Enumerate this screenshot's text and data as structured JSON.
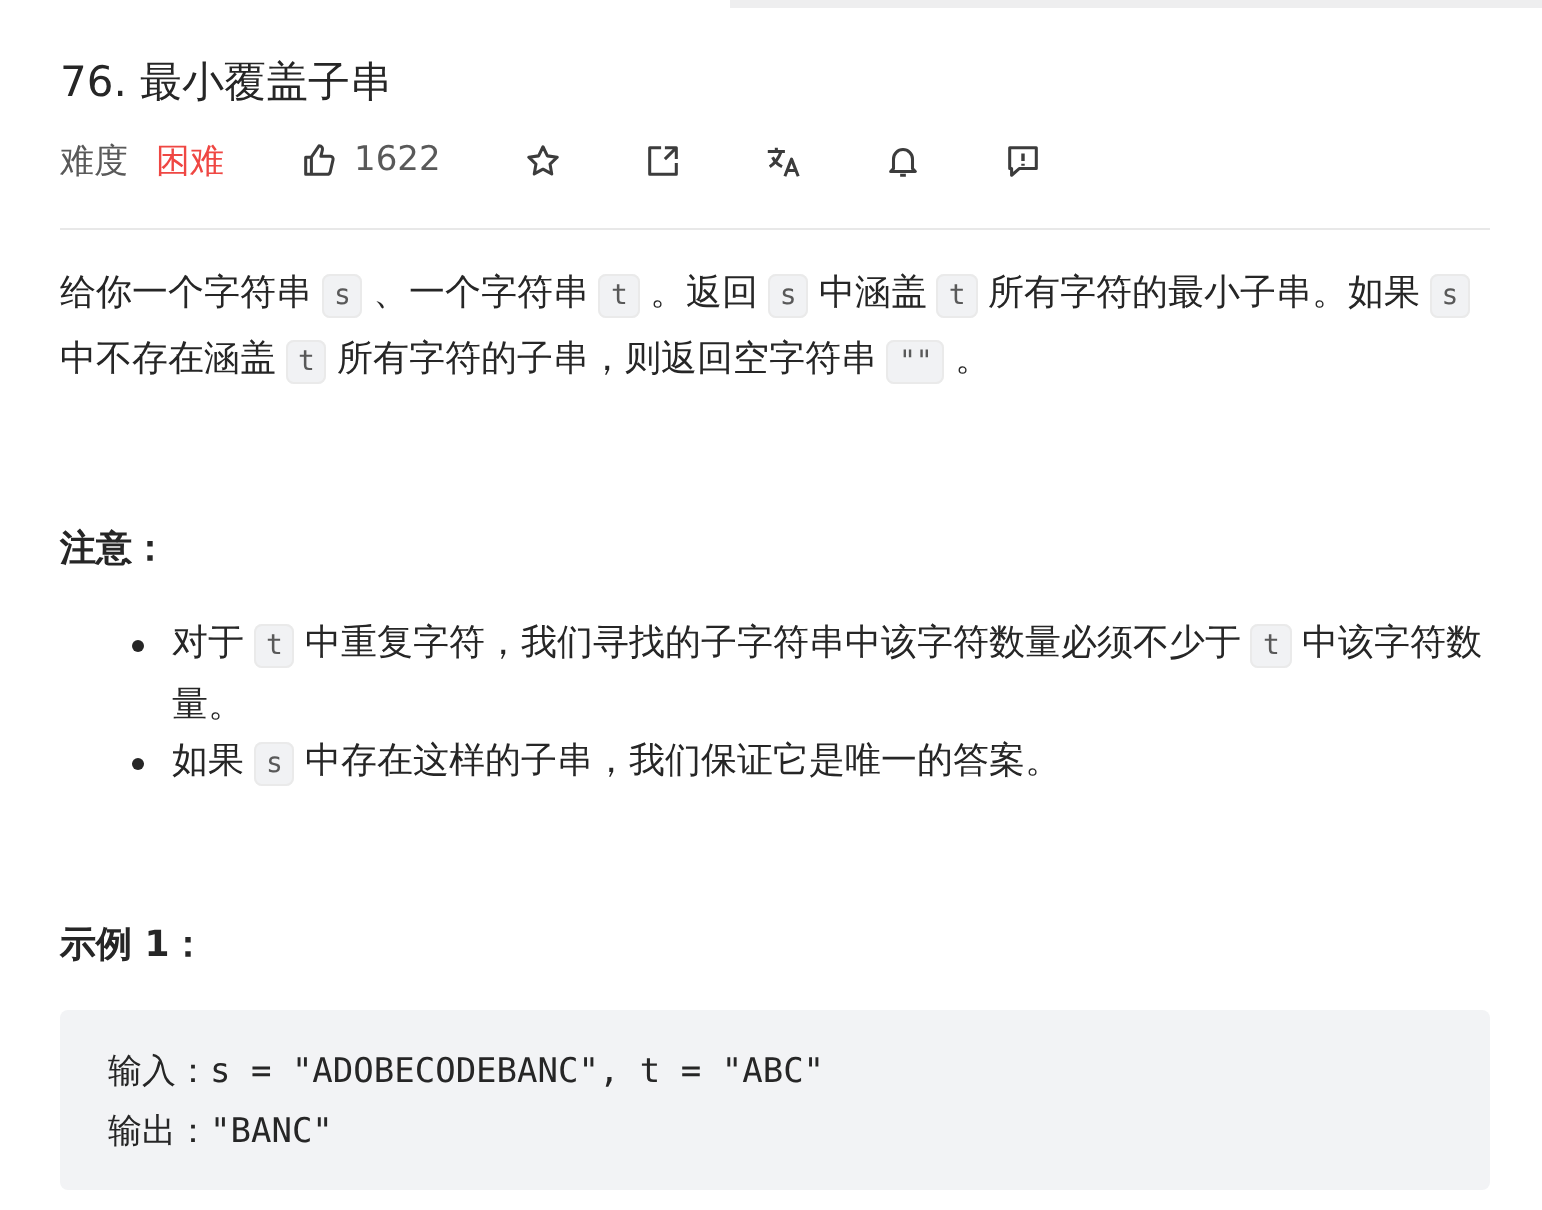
{
  "title": "76. 最小覆盖子串",
  "meta": {
    "difficulty_label": "难度",
    "difficulty": "困难",
    "likes": "1622"
  },
  "description": [
    {
      "kind": "text",
      "text": "给你一个字符串"
    },
    {
      "kind": "code",
      "text": "s"
    },
    {
      "kind": "text",
      "text": "、一个字符串"
    },
    {
      "kind": "code",
      "text": "t"
    },
    {
      "kind": "text",
      "text": "。返回"
    },
    {
      "kind": "code",
      "text": "s"
    },
    {
      "kind": "text",
      "text": "中涵盖"
    },
    {
      "kind": "code",
      "text": "t"
    },
    {
      "kind": "text",
      "text": "所有字符的最小子串。如果"
    },
    {
      "kind": "code",
      "text": "s"
    },
    {
      "kind": "text",
      "text": "中不存在涵盖"
    },
    {
      "kind": "code",
      "text": "t"
    },
    {
      "kind": "text",
      "text": "所有字符的子串，则返回空字符串"
    },
    {
      "kind": "code",
      "text": "\"\""
    },
    {
      "kind": "text",
      "text": "。"
    }
  ],
  "note": {
    "heading": "注意：",
    "items": [
      [
        {
          "kind": "text",
          "text": "对于"
        },
        {
          "kind": "code",
          "text": "t"
        },
        {
          "kind": "text",
          "text": "中重复字符，我们寻找的子字符串中该字符数量必须不少于"
        },
        {
          "kind": "code",
          "text": "t"
        },
        {
          "kind": "text",
          "text": "中该字符数量。"
        }
      ],
      [
        {
          "kind": "text",
          "text": "如果"
        },
        {
          "kind": "code",
          "text": "s"
        },
        {
          "kind": "text",
          "text": "中存在这样的子串，我们保证它是唯一的答案。"
        }
      ]
    ]
  },
  "example": {
    "heading": "示例 1：",
    "lines": [
      "输入：s = \"ADOBECODEBANC\", t = \"ABC\"",
      "输出：\"BANC\""
    ]
  }
}
